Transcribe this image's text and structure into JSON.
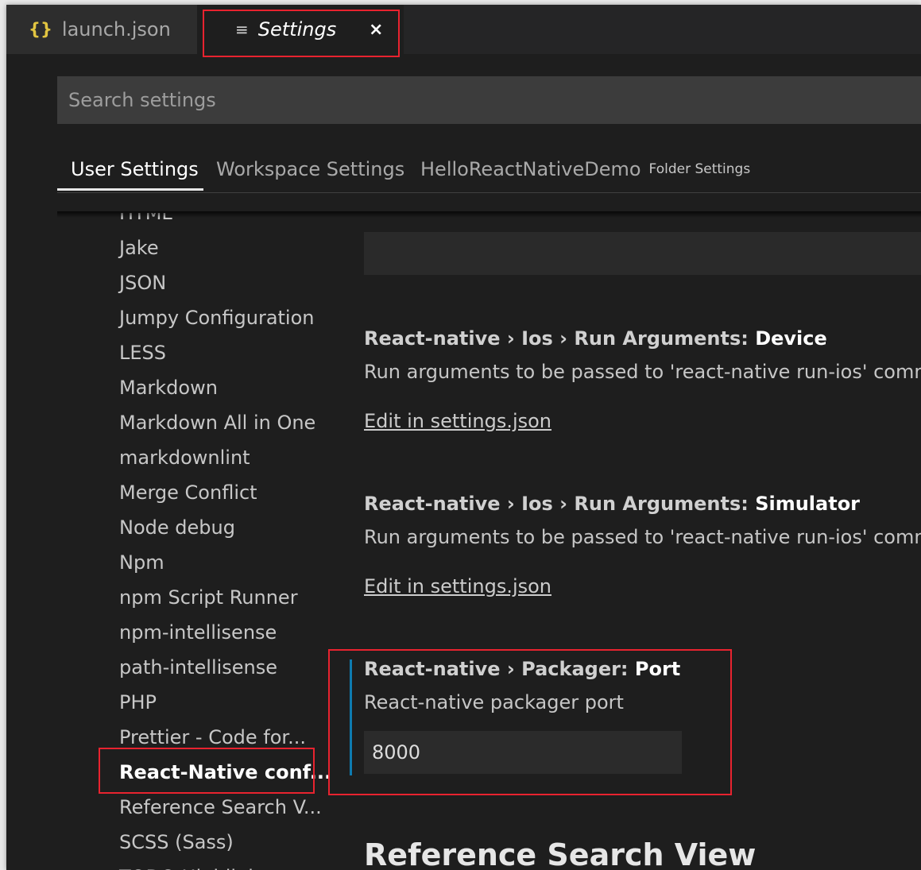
{
  "tabs": {
    "launch": {
      "icon": "json-braces-icon",
      "glyph": "{}",
      "label": "launch.json"
    },
    "settings": {
      "icon": "settings-lines-icon",
      "glyph": "≡",
      "label": "Settings",
      "close_glyph": "×"
    }
  },
  "search": {
    "placeholder": "Search settings",
    "value": ""
  },
  "scope_tabs": {
    "user": "User Settings",
    "workspace": "Workspace Settings",
    "folder_name": "HelloReactNativeDemo",
    "folder_suffix": "Folder Settings"
  },
  "toc": {
    "items": [
      "HTML",
      "Jake",
      "JSON",
      "Jumpy Configuration",
      "LESS",
      "Markdown",
      "Markdown All in One",
      "markdownlint",
      "Merge Conflict",
      "Node debug",
      "Npm",
      "npm Script Runner",
      "npm-intellisense",
      "path-intellisense",
      "PHP",
      "Prettier - Code for...",
      "React-Native conf...",
      "Reference Search V...",
      "SCSS (Sass)",
      "TODO Highlight"
    ],
    "active_index": 16
  },
  "settings": [
    {
      "crumb": "React-native › Ios › Run Arguments: ",
      "key": "Device",
      "description": "Run arguments to be passed to 'react-native run-ios' comma",
      "link": "Edit in settings.json"
    },
    {
      "crumb": "React-native › Ios › Run Arguments: ",
      "key": "Simulator",
      "description": "Run arguments to be passed to 'react-native run-ios' comma",
      "link": "Edit in settings.json"
    },
    {
      "crumb": "React-native › Packager: ",
      "key": "Port",
      "description": "React-native packager port",
      "value": "8000"
    }
  ],
  "section_heading": "Reference Search View",
  "colors": {
    "background": "#1e1e1e",
    "highlight_box": "#e8232f",
    "modified_indicator": "#0e7bb0",
    "json_icon": "#e2c541"
  }
}
